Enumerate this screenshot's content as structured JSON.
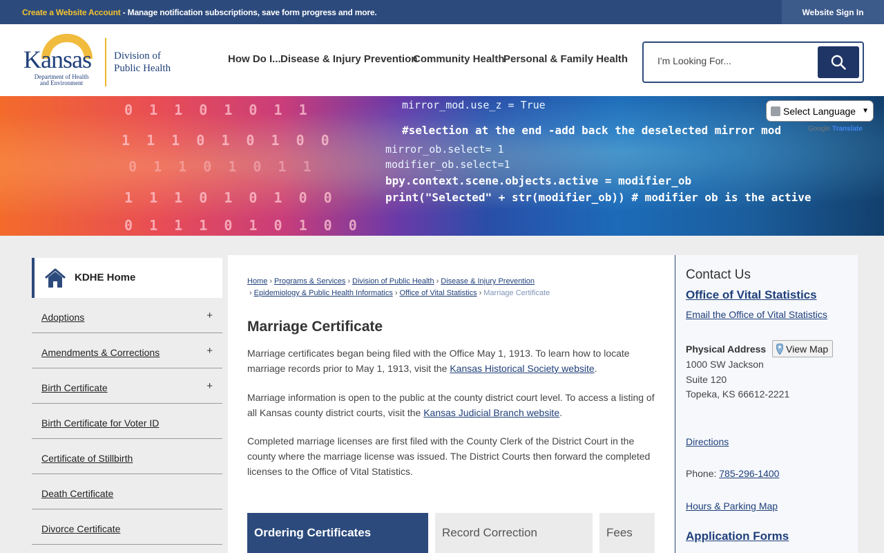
{
  "topbar": {
    "create_link": "Create a Website Account",
    "message": " - Manage notification subscriptions, save form progress and more.",
    "signin": "Website Sign In"
  },
  "logo": {
    "name": "Kansas",
    "dept": "Department of Health and Environment",
    "division_line1": "Division of",
    "division_line2": "Public Health"
  },
  "nav": [
    "How Do I...",
    "Disease & Injury Prevention",
    "Community Health",
    "Personal & Family Health"
  ],
  "search": {
    "placeholder": "I'm Looking For..."
  },
  "banner": {
    "binary_rows": [
      "0 1 1 0 1 0 1 1",
      "1 1 1 0 1 0 1 0 0",
      "0 1 1 0 1 0 1 1",
      "1 1 1 0 1 0 1 0 0",
      "0 1 1 1 0 1 0 1 0 0"
    ],
    "code_lines": [
      "mirror_mod.use_z = True",
      "#selection at the end -add back the deselected mirror mod",
      "mirror_ob.select= 1",
      "modifier_ob.select=1",
      "bpy.context.scene.objects.active = modifier_ob",
      "print(\"Selected\" + str(modifier_ob)) # modifier ob is the active"
    ]
  },
  "translate": {
    "label": "Select Language",
    "powered_prefix": "Google",
    "powered_suffix": "Translate"
  },
  "sidebar": {
    "home": "KDHE Home",
    "items": [
      {
        "label": "Adoptions",
        "expand": "+"
      },
      {
        "label": "Amendments & Corrections",
        "expand": "+"
      },
      {
        "label": "Birth Certificate",
        "expand": "+"
      },
      {
        "label": "Birth Certificate for Voter ID",
        "expand": ""
      },
      {
        "label": "Certificate of Stillbirth",
        "expand": ""
      },
      {
        "label": "Death Certificate",
        "expand": ""
      },
      {
        "label": "Divorce Certificate",
        "expand": ""
      }
    ]
  },
  "breadcrumbs": {
    "items": [
      "Home",
      "Programs & Services",
      "Division of Public Health",
      "Disease & Injury Prevention",
      "Epidemiology & Public Health Informatics",
      "Office of Vital Statistics"
    ],
    "current": "Marriage Certificate",
    "separator": "›"
  },
  "page": {
    "title": "Marriage Certificate",
    "p1_text": "Marriage certificates began being filed with the Office May 1, 1913. To learn how to locate marriage records prior to May 1, 1913, visit the ",
    "p1_link": "Kansas Historical Society website",
    "p2_text": "Marriage information is open to the public at the county district court level. To access a listing of all Kansas county district courts, visit the ",
    "p2_link": "Kansas Judicial Branch website",
    "p3_text": "Completed marriage licenses are first filed with the County Clerk of the District Court in the county where the marriage license was issued. The District Courts then forward the completed licenses to the Office of Vital Statistics.",
    "period": "."
  },
  "tabs": [
    "Ordering Certificates",
    "Record Correction",
    "Fees"
  ],
  "contact": {
    "heading": "Contact Us",
    "org": "Office of Vital Statistics",
    "email": "Email the Office of Vital Statistics",
    "address_label": "Physical Address",
    "view_map": "View Map",
    "address1": "1000 SW Jackson",
    "address2": "Suite 120",
    "address3": "Topeka, KS 66612-2221",
    "directions": "Directions",
    "phone_label": "Phone: ",
    "phone": "785-296-1400",
    "hours": "Hours & Parking Map",
    "forms": "Application Forms"
  },
  "colors": {
    "brand": "#2c4a7c",
    "accent": "#f2c230",
    "link": "#1f3f7a"
  }
}
